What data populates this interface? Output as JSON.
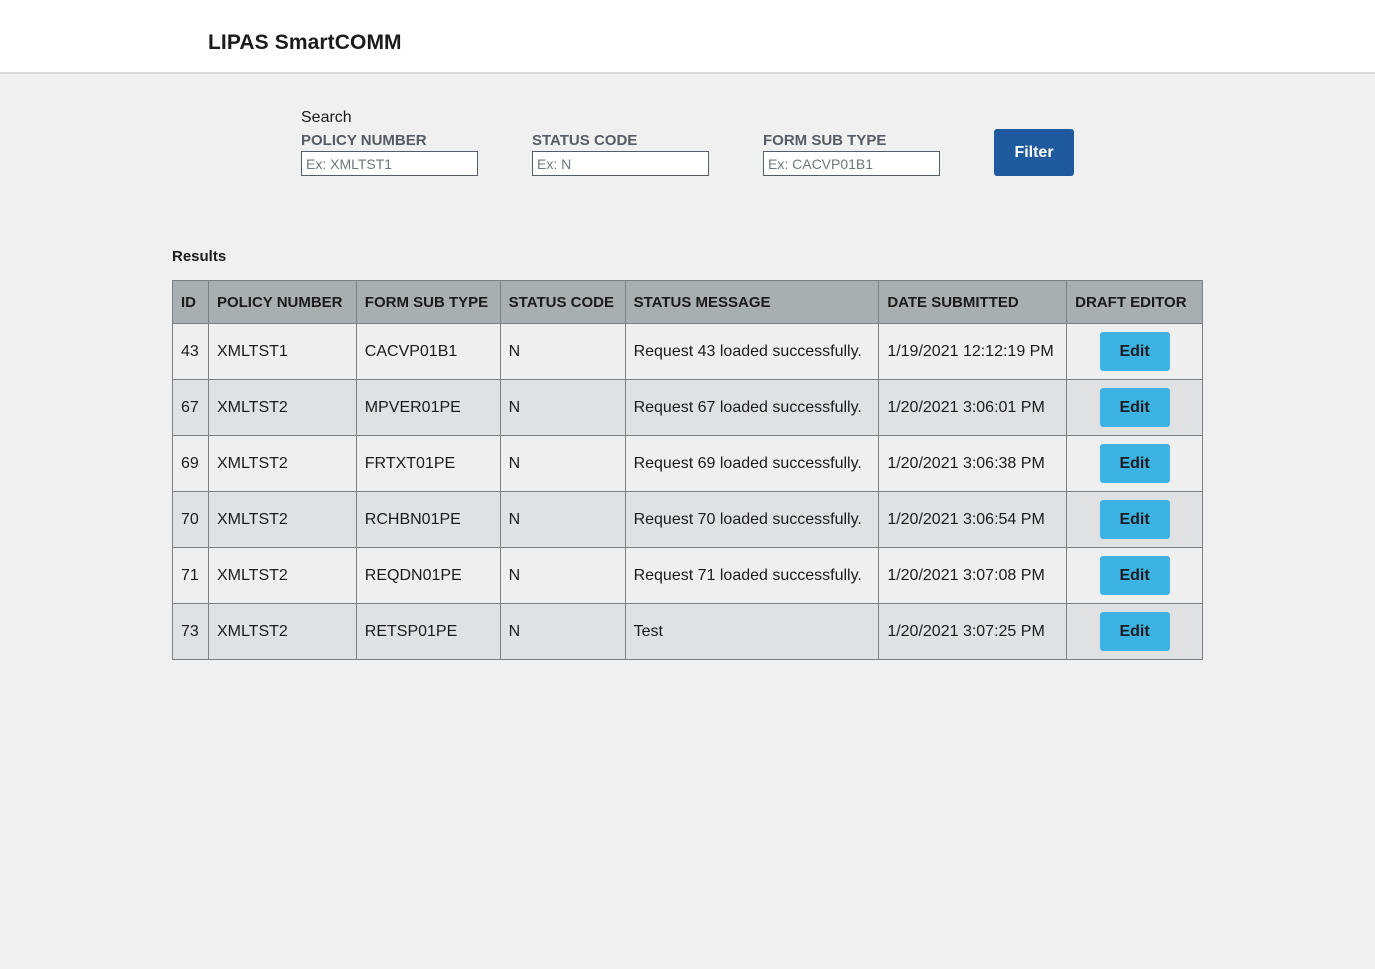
{
  "header": {
    "title": "LIPAS SmartCOMM"
  },
  "search": {
    "label": "Search",
    "policy_number": {
      "label": "POLICY NUMBER",
      "placeholder": "Ex: XMLTST1",
      "value": ""
    },
    "status_code": {
      "label": "STATUS CODE",
      "placeholder": "Ex: N",
      "value": ""
    },
    "form_sub_type": {
      "label": "FORM SUB TYPE",
      "placeholder": "Ex: CACVP01B1",
      "value": ""
    },
    "filter_label": "Filter"
  },
  "results": {
    "label": "Results",
    "columns": [
      "ID",
      "POLICY NUMBER",
      "FORM SUB TYPE",
      "STATUS CODE",
      "STATUS MESSAGE",
      "DATE SUBMITTED",
      "DRAFT EDITOR"
    ],
    "edit_label": "Edit",
    "rows": [
      {
        "id": "43",
        "policy": "XMLTST1",
        "form": "CACVP01B1",
        "status": "N",
        "message": "Request 43 loaded successfully.",
        "date": "1/19/2021 12:12:19 PM"
      },
      {
        "id": "67",
        "policy": "XMLTST2",
        "form": "MPVER01PE",
        "status": "N",
        "message": "Request 67 loaded successfully.",
        "date": "1/20/2021 3:06:01 PM"
      },
      {
        "id": "69",
        "policy": "XMLTST2",
        "form": "FRTXT01PE",
        "status": "N",
        "message": "Request 69 loaded successfully.",
        "date": "1/20/2021 3:06:38 PM"
      },
      {
        "id": "70",
        "policy": "XMLTST2",
        "form": "RCHBN01PE",
        "status": "N",
        "message": "Request 70 loaded successfully.",
        "date": "1/20/2021 3:06:54 PM"
      },
      {
        "id": "71",
        "policy": "XMLTST2",
        "form": "REQDN01PE",
        "status": "N",
        "message": "Request 71 loaded successfully.",
        "date": "1/20/2021 3:07:08 PM"
      },
      {
        "id": "73",
        "policy": "XMLTST2",
        "form": "RETSP01PE",
        "status": "N",
        "message": "Test",
        "date": "1/20/2021 3:07:25 PM"
      }
    ]
  },
  "colors": {
    "filter_button": "#1f5a9e",
    "edit_button": "#3db3e3",
    "table_header": "#a9aeb1",
    "page_background": "#f0f0f0"
  }
}
